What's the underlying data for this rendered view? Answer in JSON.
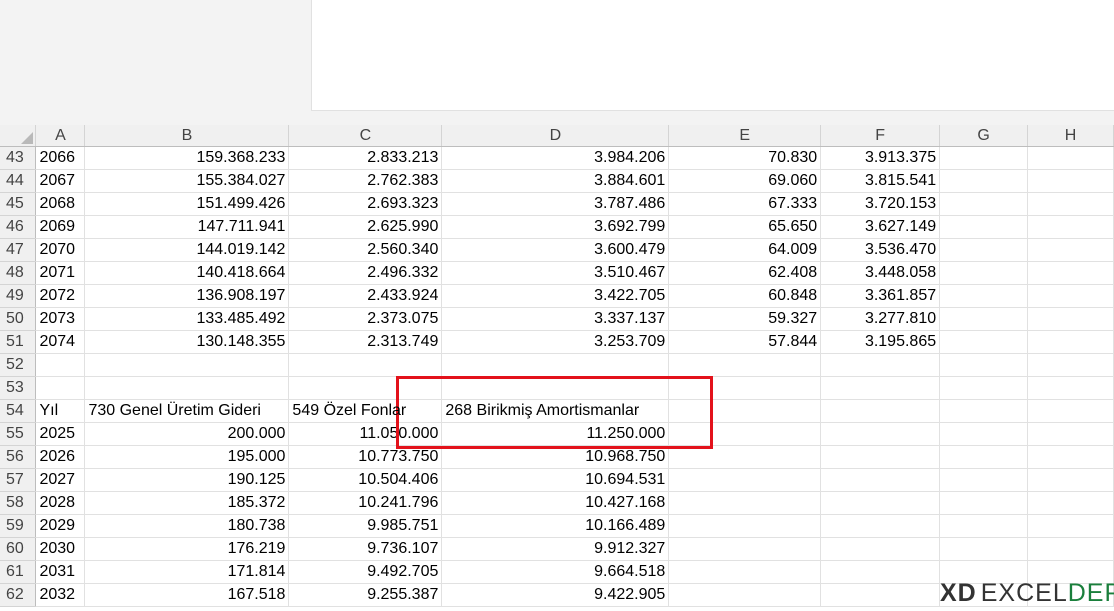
{
  "columns": [
    "A",
    "B",
    "C",
    "D",
    "E",
    "F",
    "G",
    "H"
  ],
  "rows": [
    {
      "n": "43",
      "a": "2066",
      "b": "159.368.233",
      "c": "2.833.213",
      "d": "3.984.206",
      "e": "70.830",
      "f": "3.913.375"
    },
    {
      "n": "44",
      "a": "2067",
      "b": "155.384.027",
      "c": "2.762.383",
      "d": "3.884.601",
      "e": "69.060",
      "f": "3.815.541"
    },
    {
      "n": "45",
      "a": "2068",
      "b": "151.499.426",
      "c": "2.693.323",
      "d": "3.787.486",
      "e": "67.333",
      "f": "3.720.153"
    },
    {
      "n": "46",
      "a": "2069",
      "b": "147.711.941",
      "c": "2.625.990",
      "d": "3.692.799",
      "e": "65.650",
      "f": "3.627.149"
    },
    {
      "n": "47",
      "a": "2070",
      "b": "144.019.142",
      "c": "2.560.340",
      "d": "3.600.479",
      "e": "64.009",
      "f": "3.536.470"
    },
    {
      "n": "48",
      "a": "2071",
      "b": "140.418.664",
      "c": "2.496.332",
      "d": "3.510.467",
      "e": "62.408",
      "f": "3.448.058"
    },
    {
      "n": "49",
      "a": "2072",
      "b": "136.908.197",
      "c": "2.433.924",
      "d": "3.422.705",
      "e": "60.848",
      "f": "3.361.857"
    },
    {
      "n": "50",
      "a": "2073",
      "b": "133.485.492",
      "c": "2.373.075",
      "d": "3.337.137",
      "e": "59.327",
      "f": "3.277.810"
    },
    {
      "n": "51",
      "a": "2074",
      "b": "130.148.355",
      "c": "2.313.749",
      "d": "3.253.709",
      "e": "57.844",
      "f": "3.195.865"
    },
    {
      "n": "52",
      "a": "",
      "b": "",
      "c": "",
      "d": "",
      "e": "",
      "f": ""
    },
    {
      "n": "53",
      "a": "",
      "b": "",
      "c": "",
      "d": "",
      "e": "",
      "f": ""
    },
    {
      "n": "54",
      "header": true,
      "a": "Yıl",
      "b": "730 Genel Üretim Gideri",
      "c": "549 Özel Fonlar",
      "d": "268 Birikmiş Amortismanlar",
      "e": "",
      "f": ""
    },
    {
      "n": "55",
      "a": "2025",
      "b": "200.000",
      "c": "11.050.000",
      "d": "11.250.000",
      "e": "",
      "f": ""
    },
    {
      "n": "56",
      "a": "2026",
      "b": "195.000",
      "c": "10.773.750",
      "d": "10.968.750",
      "e": "",
      "f": ""
    },
    {
      "n": "57",
      "a": "2027",
      "b": "190.125",
      "c": "10.504.406",
      "d": "10.694.531",
      "e": "",
      "f": ""
    },
    {
      "n": "58",
      "a": "2028",
      "b": "185.372",
      "c": "10.241.796",
      "d": "10.427.168",
      "e": "",
      "f": ""
    },
    {
      "n": "59",
      "a": "2029",
      "b": "180.738",
      "c": "9.985.751",
      "d": "10.166.489",
      "e": "",
      "f": ""
    },
    {
      "n": "60",
      "a": "2030",
      "b": "176.219",
      "c": "9.736.107",
      "d": "9.912.327",
      "e": "",
      "f": ""
    },
    {
      "n": "61",
      "a": "2031",
      "b": "171.814",
      "c": "9.492.705",
      "d": "9.664.518",
      "e": "",
      "f": ""
    },
    {
      "n": "62",
      "a": "2032",
      "b": "167.518",
      "c": "9.255.387",
      "d": "9.422.905",
      "e": "",
      "f": ""
    }
  ],
  "logo": {
    "mark": "XD",
    "part1": "EXCEL",
    "part2": "DEPO",
    "accent_color": "#1a7f3c"
  },
  "highlight_color": "#e3121b"
}
